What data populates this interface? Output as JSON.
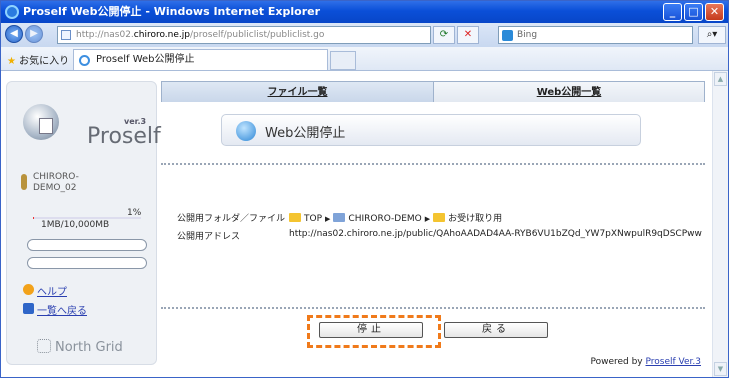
{
  "window": {
    "title": "Proself Web公開停止 - Windows Internet Explorer",
    "buttons": {
      "minimize": "_",
      "maximize": "□",
      "close": "✕"
    }
  },
  "address": {
    "prefix": "http://nas02.",
    "domain": "chiroro.ne.jp",
    "path": "/proself/publiclist/publiclist.go"
  },
  "search": {
    "placeholder": "Bing"
  },
  "favorites": {
    "label": "お気に入り",
    "tab_title": "Proself Web公開停止"
  },
  "sidebar": {
    "version": "ver.3",
    "brand": "Proself",
    "user_line1": "CHIRORO-",
    "user_line2": "DEMO_02",
    "usage_percent_label": "1%",
    "usage_percent": 1,
    "usage_text": "1MB/10,000MB",
    "links": [
      {
        "label": "ヘルプ"
      },
      {
        "label": "一覧へ戻る"
      }
    ],
    "footer_logo": "North Grid"
  },
  "main": {
    "tabs": [
      {
        "label": "ファイル一覧"
      },
      {
        "label": "Web公開一覧"
      }
    ],
    "panel_title": "Web公開停止",
    "folder_label": "公開用フォルダ／ファイル",
    "path": [
      "TOP",
      "CHIRORO-DEMO",
      "お受け取り用"
    ],
    "address_label": "公開用アドレス",
    "address_value": "http://nas02.chiroro.ne.jp/public/QAhoAADAD4AA-RYB6VU1bZQd_YW7pXNwpulR9qDSCPww",
    "stop_button": "停止",
    "back_button": "戻る",
    "powered_prefix": "Powered by ",
    "powered_link": "Proself Ver.3"
  },
  "colors": {
    "highlight": "#f07a1a",
    "link": "#2a3fb0"
  }
}
